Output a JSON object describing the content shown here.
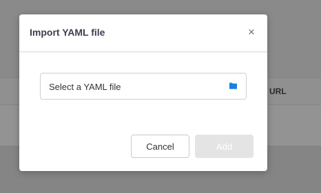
{
  "background": {
    "table_header_partial_label": "e URL"
  },
  "modal": {
    "title": "Import YAML file",
    "close_glyph": "×",
    "file_input": {
      "placeholder": "Select a YAML file",
      "icon": "folder-icon"
    },
    "buttons": {
      "cancel_label": "Cancel",
      "add_label": "Add"
    }
  },
  "colors": {
    "overlay": "#8a8a8a",
    "accent_blue": "#1a7fe0",
    "title_text": "#3d3d4f",
    "disabled_button": "#e4e4e4"
  }
}
